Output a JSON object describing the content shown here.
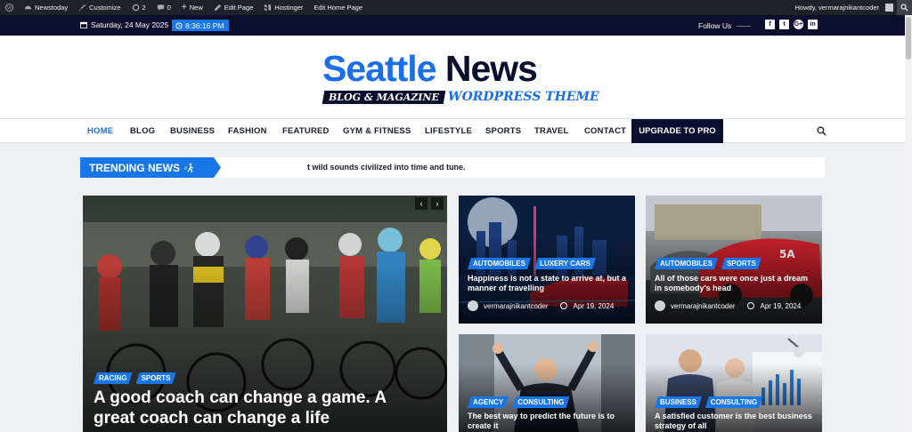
{
  "admin_bar": {
    "site": "Newstoday",
    "customize": "Customize",
    "updates": "2",
    "comments": "0",
    "new": "New",
    "edit_page": "Edit Page",
    "hostinger": "Hostinger",
    "edit_home": "Edit Home Page",
    "howdy": "Howdy, vermarajnikantcoder"
  },
  "topbar": {
    "date": "Saturday, 24 May 2025",
    "time": "8:36:16 PM",
    "follow": "Follow Us",
    "social_icons": [
      "facebook-icon",
      "twitter-icon",
      "google-plus-icon",
      "linkedin-icon"
    ]
  },
  "logo": {
    "word1": "Seattle",
    "word2": "News",
    "tagline1": "BLOG & MAGAZINE",
    "tagline2": "WORDPRESS THEME"
  },
  "nav": {
    "items": [
      "HOME",
      "BLOG",
      "BUSINESS",
      "FASHION",
      "FEATURED",
      "GYM & FITNESS",
      "LIFESTYLE",
      "SPORTS",
      "TRAVEL",
      "CONTACT"
    ],
    "active": "HOME",
    "upgrade": "UPGRADE TO PRO"
  },
  "trending": {
    "label": "TRENDING NEWS",
    "text": "t wild sounds civilized into time and tune."
  },
  "featured": {
    "tags": [
      "RACING",
      "SPORTS"
    ],
    "title": "A good coach can change a game. A great coach can change a life"
  },
  "cards": [
    {
      "tags": [
        "AUTOMOBILES",
        "LUXERY CARS"
      ],
      "title": "Happiness is not a state to arrive at, but a manner of travelling",
      "author": "vermarajnikantcoder",
      "date": "Apr 19, 2024"
    },
    {
      "tags": [
        "AUTOMOBILES",
        "SPORTS"
      ],
      "title": "All of those cars were once just a dream in somebody's head",
      "author": "vermarajnikantcoder",
      "date": "Apr 19, 2024"
    },
    {
      "tags": [
        "AGENCY",
        "CONSULTING"
      ],
      "title": "The best way to predict the future is to create it"
    },
    {
      "tags": [
        "BUSINESS",
        "CONSULTING"
      ],
      "title": "A satisfied customer is the best business strategy of all"
    }
  ],
  "colors": {
    "accent": "#1976e6",
    "navy": "#0b0f2e",
    "admin": "#1d2327"
  }
}
